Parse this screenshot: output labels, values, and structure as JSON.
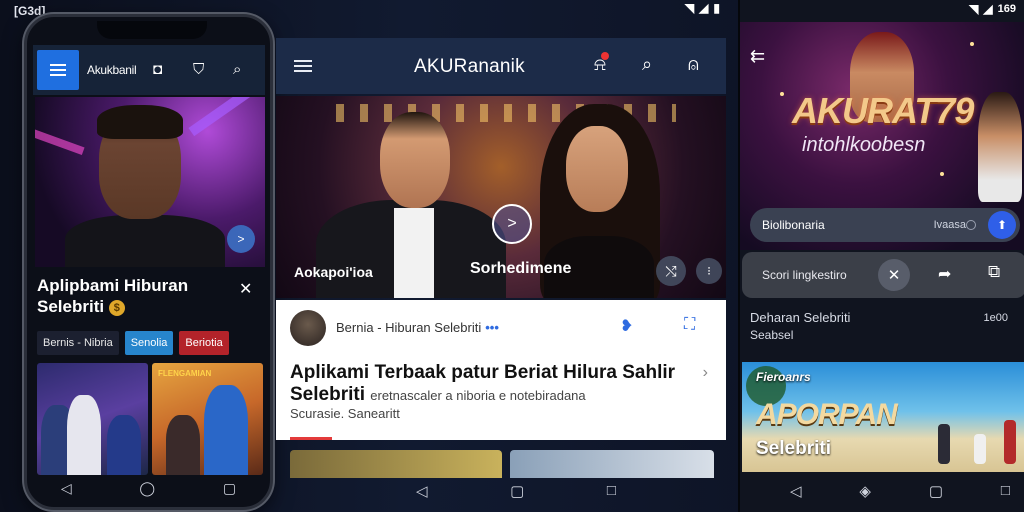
{
  "status": {
    "time_left": "[G3d]",
    "battery_mid": "⚲ ⛶ ⛶ ⌂ ⚫",
    "time_right": "169"
  },
  "phone": {
    "app_title": "Akukbanil",
    "hero_title": "Aplipbami Hiburan Selebriti",
    "chips": [
      "Bernis - Nibria",
      "Senolia",
      "Beriotia"
    ],
    "thumb_caption": "FLENGAMIAN"
  },
  "middle": {
    "app_title": "AKURananik",
    "hero_left": "Aokapoi'ioa",
    "hero_center": "Sorhedimene",
    "byline": "Bernia - Hiburan Selebriti",
    "byline_dots": "•••",
    "headline": "Aplikami Terbaak patur Beriat Hilura Sahlir Selebriti",
    "headline_tail": "eretnascaler a niboria e notebiradana",
    "subline": "Scurasie. Sanearitt"
  },
  "right": {
    "brand": "AKURAT79",
    "tagline": "intohlkoobesn",
    "search_text": "Biolibonaria",
    "search_hint": "Ivaasa",
    "sheet_label": "Scori lingkestiro",
    "item_title": "Deharan Selebriti",
    "item_sub": "Seabsel",
    "item_time": "1e00",
    "card_label": "Fieroanrs",
    "card_big": "APORPAN",
    "card_sub": "Selebriti"
  },
  "icons": {
    "menu": "menu-icon",
    "bell": "bell-icon",
    "search": "search-icon",
    "profile": "profile-icon",
    "play": "play-icon",
    "close": "close-icon",
    "share": "share-icon",
    "back": "back-icon"
  },
  "colors": {
    "accent_blue": "#1f6fe0",
    "app_bar": "#1c2b48",
    "chip_blue": "#2785cc",
    "chip_red": "#b3232a",
    "brand_gold": "#f3c98a"
  }
}
